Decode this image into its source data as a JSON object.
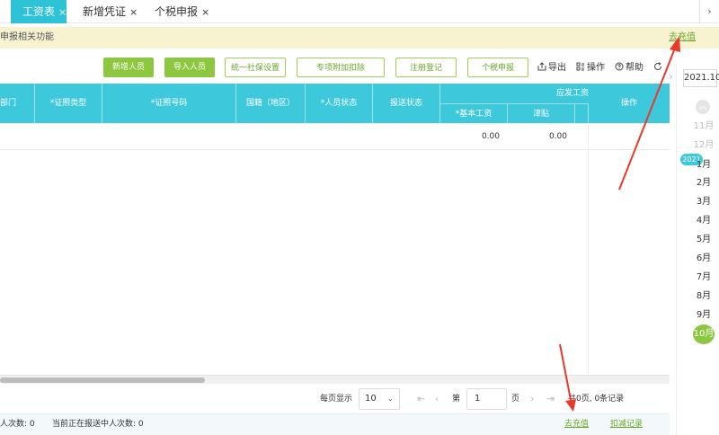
{
  "tabs": [
    {
      "label": "工资表",
      "close": "×"
    },
    {
      "label": "新增凭证",
      "close": "×"
    },
    {
      "label": "个税申报",
      "close": "×"
    }
  ],
  "tab_more": "›",
  "notice": {
    "text": "申报相关功能",
    "link": "去充值"
  },
  "toolbar": {
    "add_person": "新增人员",
    "import_person": "导入人员",
    "social_security": "统一社保设置",
    "special_deduction": "专项附加扣除",
    "register": "注册登记",
    "tax_declare": "个税申报",
    "export": "导出",
    "operate": "操作",
    "help": "帮助"
  },
  "table": {
    "headers": {
      "dept": "部门",
      "id_type": "*证照类型",
      "id_number": "*证照号码",
      "nationality": "国籍（地区）",
      "person_status": "*人员状态",
      "report_status": "报送状态",
      "payable_group": "应发工资",
      "base_salary": "*基本工资",
      "allowance": "津贴",
      "action": "操作"
    },
    "rows": [
      {
        "base_salary": "0.00",
        "allowance": "0.00"
      }
    ]
  },
  "pager": {
    "per_page_label": "每页显示",
    "per_page": "10",
    "page_prefix": "第",
    "page": "1",
    "page_suffix": "页",
    "summary": "共0页, 0条记录"
  },
  "footer": {
    "count_label": "人次数: 0",
    "sending_label": "当前正在报送中人次数: 0",
    "recharge": "去充值",
    "deduction_record": "扣减记录"
  },
  "date_panel": {
    "period": "2021.10",
    "prev_months": [
      "11月",
      "12月"
    ],
    "year_badge": "2021",
    "months": [
      "1月",
      "2月",
      "3月",
      "4月",
      "5月",
      "6月",
      "7月",
      "8月",
      "9月"
    ],
    "current_month": "10月"
  },
  "colors": {
    "tab_active": "#2ec2d7",
    "header": "#3ec8dc",
    "green": "#8dc63f",
    "link": "#6aa62a",
    "annotation": "#e8392b"
  }
}
